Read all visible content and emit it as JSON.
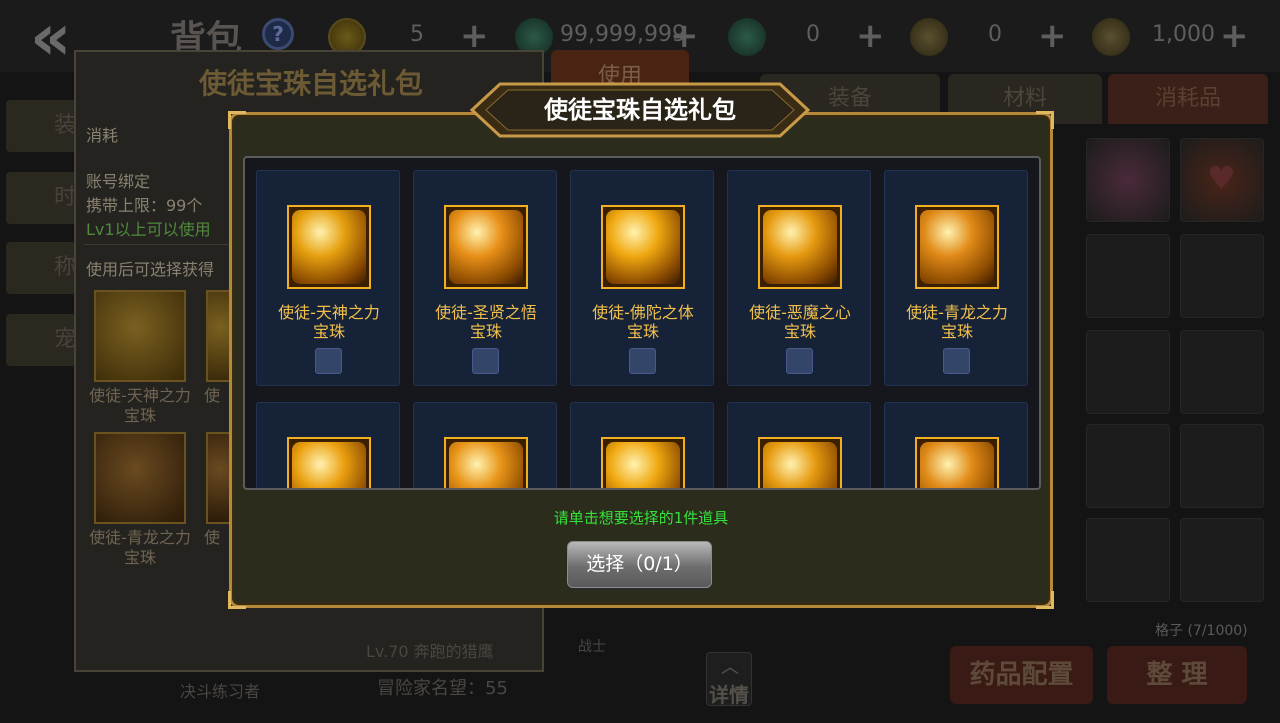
{
  "header": {
    "back_icon": "double-chevron-left-icon",
    "title": "背包",
    "help_icon": "question-icon",
    "currencies": [
      {
        "icon": "gold-coin-icon",
        "value": "5"
      },
      {
        "icon": "green-gem-icon",
        "value": "99,999,999"
      },
      {
        "icon": "green-gem-lock-icon",
        "value": "0"
      },
      {
        "icon": "bronze-coin-icon",
        "value": "0"
      },
      {
        "icon": "ticket-icon",
        "value": "1,000"
      }
    ]
  },
  "tabs": [
    {
      "label": "装备"
    },
    {
      "label": "材料"
    },
    {
      "label": "消耗品"
    }
  ],
  "side_buttons": [
    {
      "label": "装"
    },
    {
      "label": "时"
    },
    {
      "label": "称"
    },
    {
      "label": "宠"
    }
  ],
  "item_detail": {
    "title": "使徒宝珠自选礼包",
    "use_button": "使用",
    "category": "消耗",
    "binding": "账号绑定",
    "carry_limit": "携带上限：99个",
    "level_req": "Lv1以上可以使用",
    "description": "使用后可选择获得",
    "preview_items": [
      {
        "label": "使徒-天神之力宝珠"
      },
      {
        "label": "使"
      },
      {
        "label": "使徒-青龙之力宝珠"
      },
      {
        "label": "使"
      }
    ]
  },
  "background_text": {
    "character_name": "决斗练习者",
    "reputation": "冒险家名望：55",
    "level_info": "Lv.70 奔跑的猎鹰",
    "job": "战士",
    "details_button": "详情",
    "slot_count": "格子 (7/1000)",
    "potion_button": "药品配置",
    "sort_button": "整 理"
  },
  "modal": {
    "title": "使徒宝珠自选礼包",
    "items": [
      {
        "name": "使徒-天神之力宝珠",
        "line1": "使徒-天神之力",
        "line2": "宝珠",
        "color": "#e6a010",
        "checked": false
      },
      {
        "name": "使徒-圣贤之悟宝珠",
        "line1": "使徒-圣贤之悟",
        "line2": "宝珠",
        "color": "#e89018",
        "checked": false
      },
      {
        "name": "使徒-佛陀之体宝珠",
        "line1": "使徒-佛陀之体",
        "line2": "宝珠",
        "color": "#f0a810",
        "checked": false
      },
      {
        "name": "使徒-恶魔之心宝珠",
        "line1": "使徒-恶魔之心",
        "line2": "宝珠",
        "color": "#e69a10",
        "checked": false
      },
      {
        "name": "使徒-青龙之力宝珠",
        "line1": "使徒-青龙之力",
        "line2": "宝珠",
        "color": "#e08a18",
        "checked": false
      },
      {
        "name": "",
        "line1": "",
        "line2": "",
        "color": "#eaa010",
        "checked": false
      },
      {
        "name": "",
        "line1": "",
        "line2": "",
        "color": "#e89418",
        "checked": false
      },
      {
        "name": "",
        "line1": "",
        "line2": "",
        "color": "#f0a810",
        "checked": false
      },
      {
        "name": "",
        "line1": "",
        "line2": "",
        "color": "#e69a10",
        "checked": false
      },
      {
        "name": "",
        "line1": "",
        "line2": "",
        "color": "#e08a18",
        "checked": false
      }
    ],
    "hint": "请单击想要选择的1件道具",
    "select_button": "选择（0/1）"
  },
  "colors": {
    "accent_gold": "#f0b020",
    "hint_green": "#34e23a",
    "frame_gold": "#b48a3a"
  }
}
